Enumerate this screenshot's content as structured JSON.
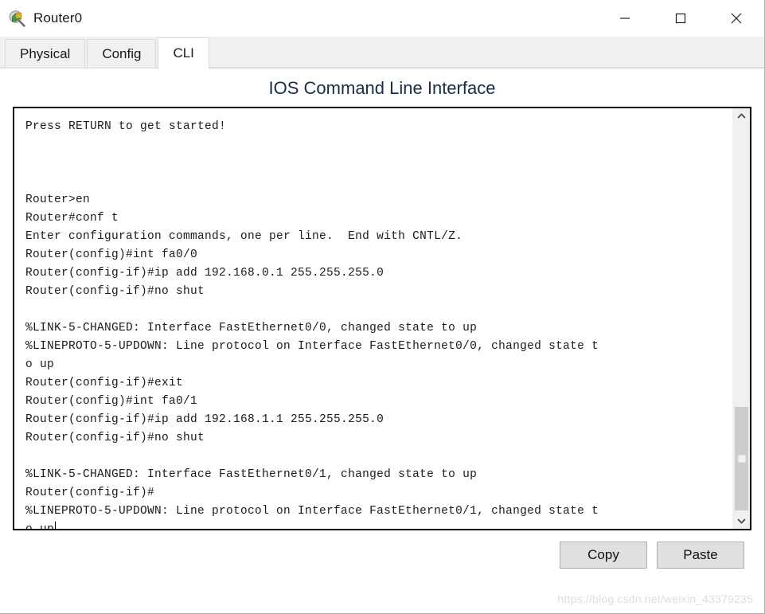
{
  "window": {
    "title": "Router0",
    "icon": "router-magnifier-icon",
    "controls": {
      "minimize_label": "—",
      "maximize_label": "□",
      "close_label": "✕"
    }
  },
  "tabs": [
    {
      "label": "Physical",
      "active": false
    },
    {
      "label": "Config",
      "active": false
    },
    {
      "label": "CLI",
      "active": true
    }
  ],
  "panel": {
    "title": "IOS Command Line Interface"
  },
  "terminal": {
    "lines": [
      "Press RETURN to get started!",
      "",
      "",
      "",
      "Router>en",
      "Router#conf t",
      "Enter configuration commands, one per line.  End with CNTL/Z.",
      "Router(config)#int fa0/0",
      "Router(config-if)#ip add 192.168.0.1 255.255.255.0",
      "Router(config-if)#no shut",
      "",
      "%LINK-5-CHANGED: Interface FastEthernet0/0, changed state to up",
      "%LINEPROTO-5-UPDOWN: Line protocol on Interface FastEthernet0/0, changed state t",
      "o up",
      "Router(config-if)#exit",
      "Router(config)#int fa0/1",
      "Router(config-if)#ip add 192.168.1.1 255.255.255.0",
      "Router(config-if)#no shut",
      "",
      "%LINK-5-CHANGED: Interface FastEthernet0/1, changed state to up",
      "Router(config-if)#",
      "%LINEPROTO-5-UPDOWN: Line protocol on Interface FastEthernet0/1, changed state t",
      "o up"
    ],
    "cursor_line_index": 22,
    "scrollbar": {
      "up_arrow": "⌃",
      "down_arrow": "⌄"
    }
  },
  "footer": {
    "copy_label": "Copy",
    "paste_label": "Paste"
  },
  "watermark": {
    "text": "https://blog.csdn.net/weixin_43379235"
  },
  "colors": {
    "panel_title": "#1c2b4a",
    "terminal_text": "#1b1b1b",
    "tab_active_bg": "#ffffff",
    "tab_inactive_bg": "#f0f0f0",
    "button_bg": "#e0e0e0",
    "scroll_thumb": "#cdcdcd"
  }
}
